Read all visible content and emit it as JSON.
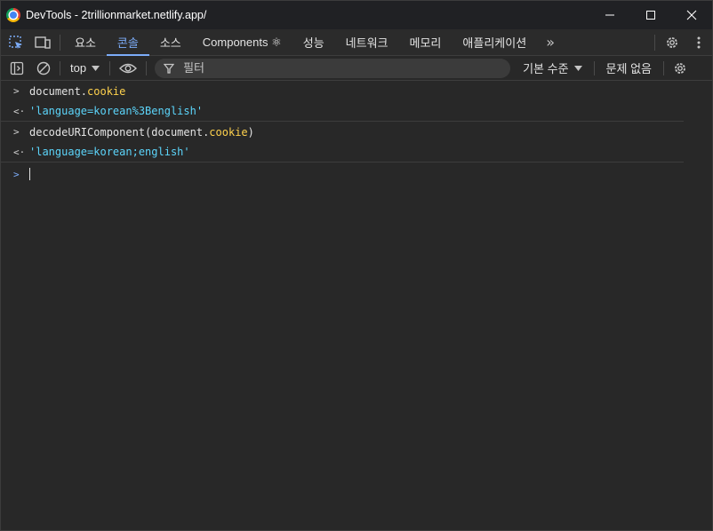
{
  "window": {
    "title": "DevTools - 2trillionmarket.netlify.app/",
    "minimize": "—",
    "maximize": "☐",
    "close": "✕"
  },
  "tabs": [
    {
      "label": "요소"
    },
    {
      "label": "콘솔",
      "active": true
    },
    {
      "label": "소스"
    },
    {
      "label": "Components ⚛"
    },
    {
      "label": "성능"
    },
    {
      "label": "네트워크"
    },
    {
      "label": "메모리"
    },
    {
      "label": "애플리케이션"
    }
  ],
  "tab_overflow": "»",
  "toolbar": {
    "context": "top",
    "filter_placeholder": "필터",
    "levels": "기본 수준",
    "issues": "문제 없음"
  },
  "console": {
    "entries": [
      {
        "type": "input",
        "parts": [
          {
            "text": "document.",
            "cls": "code"
          },
          {
            "text": "cookie",
            "cls": "prop"
          }
        ]
      },
      {
        "type": "output",
        "text": "'language=korean%3Benglish'"
      },
      {
        "type": "input",
        "parts": [
          {
            "text": "decodeURIComponent(document.",
            "cls": "code"
          },
          {
            "text": "cookie",
            "cls": "prop"
          },
          {
            "text": ")",
            "cls": "code"
          }
        ]
      },
      {
        "type": "output",
        "text": "'language=korean;english'"
      }
    ]
  },
  "colors": {
    "accent": "#7cacf8",
    "property": "#ffd24d",
    "string": "#5cd5fb",
    "background": "#282828"
  }
}
